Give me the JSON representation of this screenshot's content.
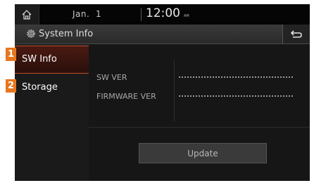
{
  "status_bar": {
    "home_icon": "home-icon",
    "date": "Jan.  1",
    "time": "12:00",
    "ampm": "AM"
  },
  "title_bar": {
    "gear_icon": "gear-icon",
    "title": "System Info",
    "back_icon": "back-arrow-icon"
  },
  "sidebar": {
    "items": [
      {
        "label": "SW Info",
        "selected": true
      },
      {
        "label": "Storage",
        "selected": false
      }
    ]
  },
  "main": {
    "rows": [
      {
        "label": "SW VER"
      },
      {
        "label": "FIRMWARE VER"
      }
    ],
    "update_label": "Update"
  },
  "callouts": [
    "1",
    "2"
  ],
  "colors": {
    "accent": "#c0502c",
    "callout": "#e8761e",
    "background": "#141414"
  }
}
